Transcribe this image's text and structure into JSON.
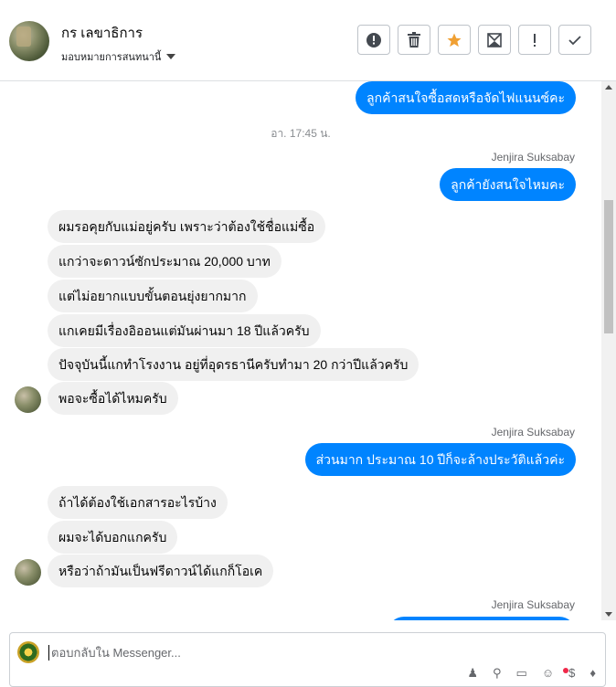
{
  "header": {
    "contact_name": "กร เลขาธิการ",
    "assign_label": "มอบหมายการสนทนานี้",
    "actions": [
      {
        "name": "spam",
        "icon": "alert-circle-icon"
      },
      {
        "name": "delete",
        "icon": "trash-icon"
      },
      {
        "name": "star",
        "icon": "star-icon"
      },
      {
        "name": "unread",
        "icon": "envelope-icon"
      },
      {
        "name": "follow-up",
        "icon": "exclamation-icon"
      },
      {
        "name": "done",
        "icon": "check-icon"
      }
    ],
    "star_color": "#f0a033"
  },
  "thread": {
    "messages": [
      {
        "id": "m1",
        "dir": "out",
        "text": "ลูกค้าสนใจซื้อสดหรือจัดไฟแนนซ์คะ"
      },
      {
        "id": "t1",
        "type": "time",
        "text": "อา. 17:45 น."
      },
      {
        "id": "s1",
        "type": "sender",
        "text": "Jenjira Suksabay"
      },
      {
        "id": "m2",
        "dir": "out",
        "text": "ลูกค้ายังสนใจไหมคะ"
      },
      {
        "id": "m3",
        "dir": "in",
        "text": "ผมรอคุยกับแม่อยู่ครับ เพราะว่าต้องใช้ชื่อแม่ซื้อ"
      },
      {
        "id": "m4",
        "dir": "in",
        "text": "แกว่าจะดาวน์ซักประมาณ 20,000 บาท"
      },
      {
        "id": "m5",
        "dir": "in",
        "text": "แต่ไม่อยากแบบขั้นตอนยุ่งยากมาก"
      },
      {
        "id": "m6",
        "dir": "in",
        "text": "แกเคยมีเรื่องอิออนแต่มันผ่านมา 18 ปีแล้วครับ"
      },
      {
        "id": "m7",
        "dir": "in",
        "text": "ปัจจุบันนี้แกทำโรงงาน อยู่ที่อุดรธานีครับทำมา 20 กว่าปีแล้วครับ"
      },
      {
        "id": "m8",
        "dir": "in",
        "text": "พอจะซื้อได้ไหมครับ"
      },
      {
        "id": "s2",
        "type": "sender",
        "text": "Jenjira Suksabay"
      },
      {
        "id": "m9",
        "dir": "out",
        "text": "ส่วนมาก ประมาณ 10 ปีก็จะล้างประวัติแล้วค่ะ"
      },
      {
        "id": "m10",
        "dir": "in",
        "text": "ถ้าได้ต้องใช้เอกสารอะไรบ้าง"
      },
      {
        "id": "m11",
        "dir": "in",
        "text": "ผมจะได้บอกแกครับ"
      },
      {
        "id": "m12",
        "dir": "in",
        "text": "หรือว่าถ้ามันเป็นฟรีดาวน์ได้แกก็โอเค"
      },
      {
        "id": "s3",
        "type": "sender",
        "text": "Jenjira Suksabay"
      }
    ]
  },
  "composer": {
    "placeholder": "ตอบกลับใน Messenger..."
  },
  "colors": {
    "outgoing": "#0084ff",
    "incoming": "#f0f0f0"
  }
}
